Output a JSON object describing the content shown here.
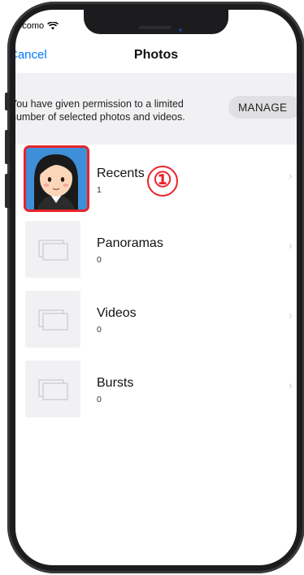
{
  "status": {
    "carrier": "docomo"
  },
  "nav": {
    "cancel_label": "Cancel",
    "title": "Photos"
  },
  "permission": {
    "line1": "You have given permission to a limited",
    "line2": "number of selected photos and videos.",
    "manage_label": "MANAGE"
  },
  "albums": [
    {
      "name": "Recents",
      "count": "1"
    },
    {
      "name": "Panoramas",
      "count": "0"
    },
    {
      "name": "Videos",
      "count": "0"
    },
    {
      "name": "Bursts",
      "count": "0"
    }
  ],
  "annotation": {
    "step": "①",
    "color": "#e8242a"
  },
  "colors": {
    "accent": "#007aff",
    "banner": "#f1f1f3",
    "frame": "#1c1c1e"
  }
}
